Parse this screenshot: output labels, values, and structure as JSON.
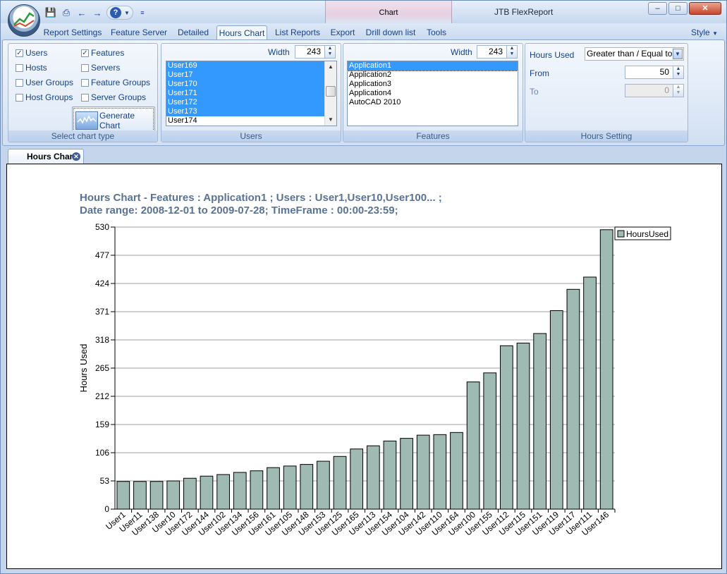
{
  "app": {
    "title": "JTB FlexReport",
    "context_tab": "Chart"
  },
  "window_controls": {
    "minimize": "–",
    "maximize": "□",
    "close": "✕"
  },
  "ribbon_tabs": [
    "Report Settings",
    "Feature Server",
    "Detailed",
    "Hours Chart",
    "List Reports",
    "Export",
    "Drill down list",
    "Tools"
  ],
  "style_menu": "Style",
  "chart_type": {
    "caption": "Select chart type",
    "options": [
      {
        "label": "Users",
        "checked": true
      },
      {
        "label": "Features",
        "checked": true
      },
      {
        "label": "Hosts",
        "checked": false
      },
      {
        "label": "Servers",
        "checked": false
      },
      {
        "label": "User Groups",
        "checked": false
      },
      {
        "label": "Feature Groups",
        "checked": false
      },
      {
        "label": "Host Groups",
        "checked": false
      },
      {
        "label": "Server Groups",
        "checked": false
      }
    ],
    "generate_label": "Generate Chart"
  },
  "users_group": {
    "caption": "Users",
    "width_label": "Width",
    "width_value": "243",
    "items": [
      "User169",
      "User17",
      "User170",
      "User171",
      "User172",
      "User173",
      "User174"
    ],
    "selected_count": 6
  },
  "features_group": {
    "caption": "Features",
    "width_label": "Width",
    "width_value": "243",
    "items": [
      "Application1",
      "Application2",
      "Application3",
      "Application4",
      "AutoCAD 2010"
    ]
  },
  "hours_group": {
    "caption": "Hours Setting",
    "hours_used_label": "Hours Used",
    "hours_used_value": "Greater than / Equal to",
    "from_label": "From",
    "from_value": "50",
    "to_label": "To",
    "to_value": "0"
  },
  "doc_tab": {
    "label": "Hours Chart"
  },
  "chart_data": {
    "type": "bar",
    "title": "Hours Chart - Features : Application1 ; Users : User1,User10,User100... ;",
    "subtitle": "Date range: 2008-12-01 to 2009-07-28; TimeFrame : 00:00-23:59;",
    "ylabel": "Hours Used",
    "xlabel": "",
    "ylim": [
      0,
      530
    ],
    "yticks": [
      "0",
      "53",
      "106",
      "159",
      "212",
      "265",
      "318",
      "371",
      "424",
      "477",
      "530"
    ],
    "grid": true,
    "legend": "top-right",
    "categories": [
      "User1",
      "User11",
      "User138",
      "User10",
      "User172",
      "User144",
      "User102",
      "User134",
      "User156",
      "User161",
      "User105",
      "User148",
      "User153",
      "User125",
      "User165",
      "User113",
      "User154",
      "User104",
      "User142",
      "User110",
      "User164",
      "User100",
      "User155",
      "User112",
      "User115",
      "User151",
      "User119",
      "User117",
      "User111",
      "User146"
    ],
    "series": [
      {
        "name": "HoursUsed",
        "color": "#9fbab3",
        "values": [
          52,
          52,
          52,
          53,
          58,
          62,
          65,
          69,
          72,
          78,
          81,
          84,
          90,
          99,
          113,
          119,
          128,
          133,
          139,
          140,
          144,
          239,
          256,
          307,
          312,
          330,
          373,
          413,
          436,
          525
        ]
      }
    ]
  }
}
